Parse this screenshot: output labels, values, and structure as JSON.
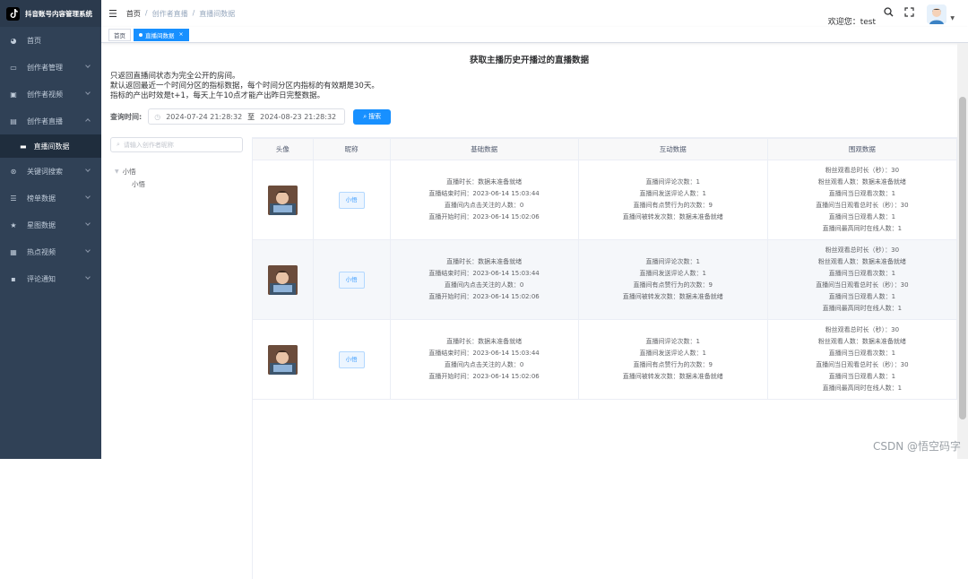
{
  "app": {
    "title": "抖音账号内容管理系统"
  },
  "sidebar": {
    "items": [
      {
        "label": "首页",
        "icon": "dashboard-icon"
      },
      {
        "label": "创作者管理",
        "icon": "monitor-icon"
      },
      {
        "label": "创作者视频",
        "icon": "video-icon"
      },
      {
        "label": "创作者直播",
        "icon": "live-icon"
      },
      {
        "label": "直播间数据",
        "icon": "screen-icon"
      },
      {
        "label": "关键词搜索",
        "icon": "keyword-icon"
      },
      {
        "label": "榜单数据",
        "icon": "list-icon"
      },
      {
        "label": "星图数据",
        "icon": "star-icon"
      },
      {
        "label": "热点视频",
        "icon": "hot-icon"
      },
      {
        "label": "评论通知",
        "icon": "comment-icon"
      }
    ]
  },
  "navbar": {
    "breadcrumb": [
      "首页",
      "创作者直播",
      "直播间数据"
    ],
    "welcome": "欢迎您：test"
  },
  "tags": {
    "home": "首页",
    "active": "直播间数据"
  },
  "page": {
    "title": "获取主播历史开播过的直播数据",
    "notes": [
      "只返回直播间状态为完全公开的房间。",
      "默认返回最近一个时间分区的指标数据，每个时间分区内指标的有效期是30天。",
      "指标的产出时效是t+1，每天上午10点才能产出昨日完整数据。"
    ],
    "query_label": "查询时间:",
    "start": "2024-07-24 21:28:32",
    "range_sep": "至",
    "end": "2024-08-23 21:28:32",
    "search_btn": "搜索",
    "author_placeholder": "请输入创作者昵称"
  },
  "tree": {
    "parent": "小悟",
    "child": "小悟"
  },
  "table": {
    "headers": [
      "头像",
      "昵称",
      "基础数据",
      "互动数据",
      "围观数据"
    ],
    "rows": [
      {
        "name": "小悟",
        "basic": [
          "直播时长：数据未准备就绪",
          "直播结束时间：2023-06-14 15:03:44",
          "直播间内点击关注的人数：0",
          "直播开始时间：2023-06-14 15:02:06"
        ],
        "interact": [
          "直播间评论次数：1",
          "直播间发送评论人数：1",
          "直播间有点赞行为的次数：9",
          "直播间被转发次数：数据未准备就绪"
        ],
        "watch": [
          "粉丝观看总时长（秒）：30",
          "粉丝观看人数：数据未准备就绪",
          "直播间当日观看次数：1",
          "直播间当日观看总时长（秒）：30",
          "直播间当日观看人数：1",
          "直播间最高同时在线人数：1"
        ]
      },
      {
        "name": "小悟",
        "basic": [
          "直播时长：数据未准备就绪",
          "直播结束时间：2023-06-14 15:03:44",
          "直播间内点击关注的人数：0",
          "直播开始时间：2023-06-14 15:02:06"
        ],
        "interact": [
          "直播间评论次数：1",
          "直播间发送评论人数：1",
          "直播间有点赞行为的次数：9",
          "直播间被转发次数：数据未准备就绪"
        ],
        "watch": [
          "粉丝观看总时长（秒）：30",
          "粉丝观看人数：数据未准备就绪",
          "直播间当日观看次数：1",
          "直播间当日观看总时长（秒）：30",
          "直播间当日观看人数：1",
          "直播间最高同时在线人数：1"
        ]
      },
      {
        "name": "小悟",
        "basic": [
          "直播时长：数据未准备就绪",
          "直播结束时间：2023-06-14 15:03:44",
          "直播间内点击关注的人数：0",
          "直播开始时间：2023-06-14 15:02:06"
        ],
        "interact": [
          "直播间评论次数：1",
          "直播间发送评论人数：1",
          "直播间有点赞行为的次数：9",
          "直播间被转发次数：数据未准备就绪"
        ],
        "watch": [
          "粉丝观看总时长（秒）：30",
          "粉丝观看人数：数据未准备就绪",
          "直播间当日观看次数：1",
          "直播间当日观看总时长（秒）：30",
          "直播间当日观看人数：1",
          "直播间最高同时在线人数：1"
        ]
      }
    ]
  },
  "watermark": "CSDN @悟空码字",
  "colors": {
    "sidebar": "#304156",
    "accent": "#1890ff"
  }
}
